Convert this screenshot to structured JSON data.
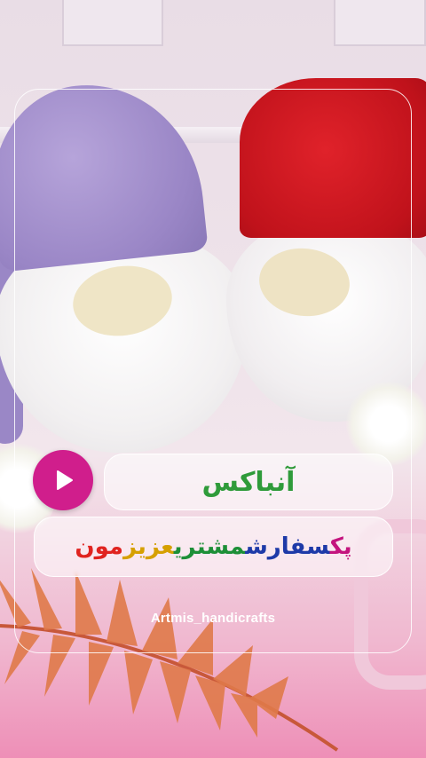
{
  "overlay": {
    "title": "آنباکس",
    "subtitle_words": [
      "پک",
      "سفارش",
      "مشتری",
      "عزیز",
      "مون"
    ],
    "handle": "Artmis_handicrafts"
  },
  "icons": {
    "play": "play-icon"
  },
  "colors": {
    "play_button": "#d01e8c",
    "title": "#2f9b3a",
    "subtitle_word_colors": [
      "#c4147e",
      "#1e3aa8",
      "#1d8f37",
      "#d6a000",
      "#e0231f"
    ]
  }
}
